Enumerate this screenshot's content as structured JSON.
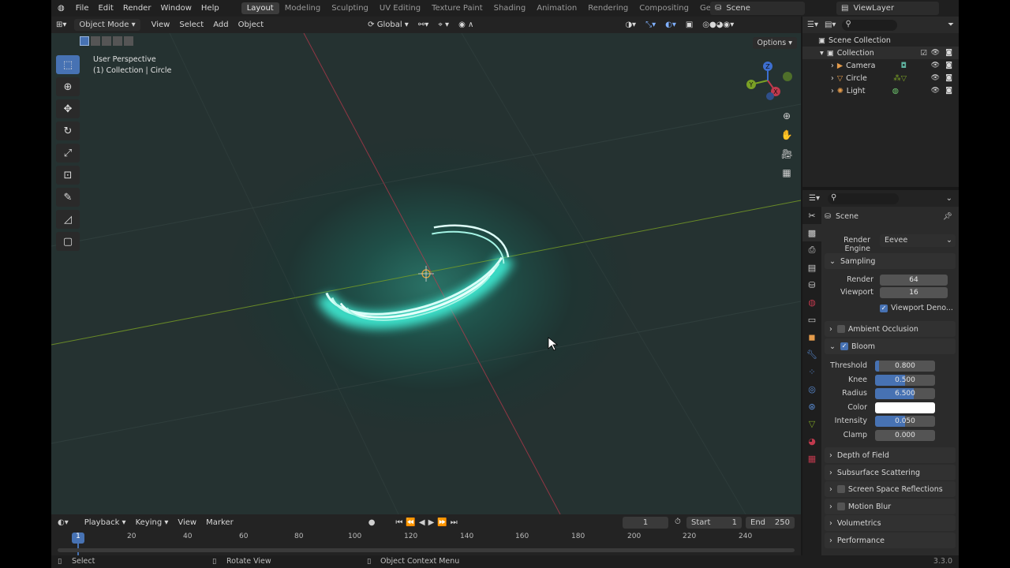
{
  "menu": [
    "File",
    "Edit",
    "Render",
    "Window",
    "Help"
  ],
  "workspaces": [
    "Layout",
    "Modeling",
    "Sculpting",
    "UV Editing",
    "Texture Paint",
    "Shading",
    "Animation",
    "Rendering",
    "Compositing",
    "Geometry Nodes"
  ],
  "scene_name": "Scene",
  "view_layer": "ViewLayer",
  "viewport_header": {
    "mode": "Object Mode",
    "view": "View",
    "select": "Select",
    "add": "Add",
    "object": "Object",
    "transform": "Global",
    "options": "Options"
  },
  "viewport_info": {
    "line1": "User Perspective",
    "line2": "(1) Collection | Circle"
  },
  "gizmo": {
    "x": "X",
    "y": "Y",
    "z": "Z"
  },
  "outliner": {
    "root": "Scene Collection",
    "collection": "Collection",
    "items": [
      "Camera",
      "Circle",
      "Light"
    ]
  },
  "properties": {
    "context": "Scene",
    "engine_label": "Render Engine",
    "engine": "Eevee",
    "sampling": {
      "title": "Sampling",
      "render_label": "Render",
      "render": "64",
      "viewport_label": "Viewport",
      "viewport": "16",
      "denoise": "Viewport Deno..."
    },
    "ambient_occlusion": "Ambient Occlusion",
    "bloom": {
      "title": "Bloom",
      "threshold_label": "Threshold",
      "threshold": "0.800",
      "threshold_fill": 0.06,
      "knee_label": "Knee",
      "knee": "0.500",
      "knee_fill": 0.5,
      "radius_label": "Radius",
      "radius": "6.500",
      "radius_fill": 0.65,
      "color_label": "Color",
      "color": "#ffffff",
      "intensity_label": "Intensity",
      "intensity": "0.050",
      "intensity_fill": 0.5,
      "clamp_label": "Clamp",
      "clamp": "0.000"
    },
    "panels": [
      "Depth of Field",
      "Subsurface Scattering",
      "Screen Space Reflections",
      "Motion Blur",
      "Volumetrics",
      "Performance"
    ]
  },
  "timeline": {
    "playback": "Playback",
    "keying": "Keying",
    "view": "View",
    "marker": "Marker",
    "current": "1",
    "start_label": "Start",
    "start": "1",
    "end_label": "End",
    "end": "250",
    "ticks": [
      "1",
      "20",
      "40",
      "60",
      "80",
      "100",
      "120",
      "140",
      "160",
      "180",
      "200",
      "220",
      "240"
    ]
  },
  "status": {
    "select": "Select",
    "rotate": "Rotate View",
    "context": "Object Context Menu",
    "version": "3.3.0"
  },
  "colors": {
    "accent": "#4772b3",
    "glow": "#3ff0d8",
    "x_axis": "#c0394d",
    "y_axis": "#7aa025"
  }
}
